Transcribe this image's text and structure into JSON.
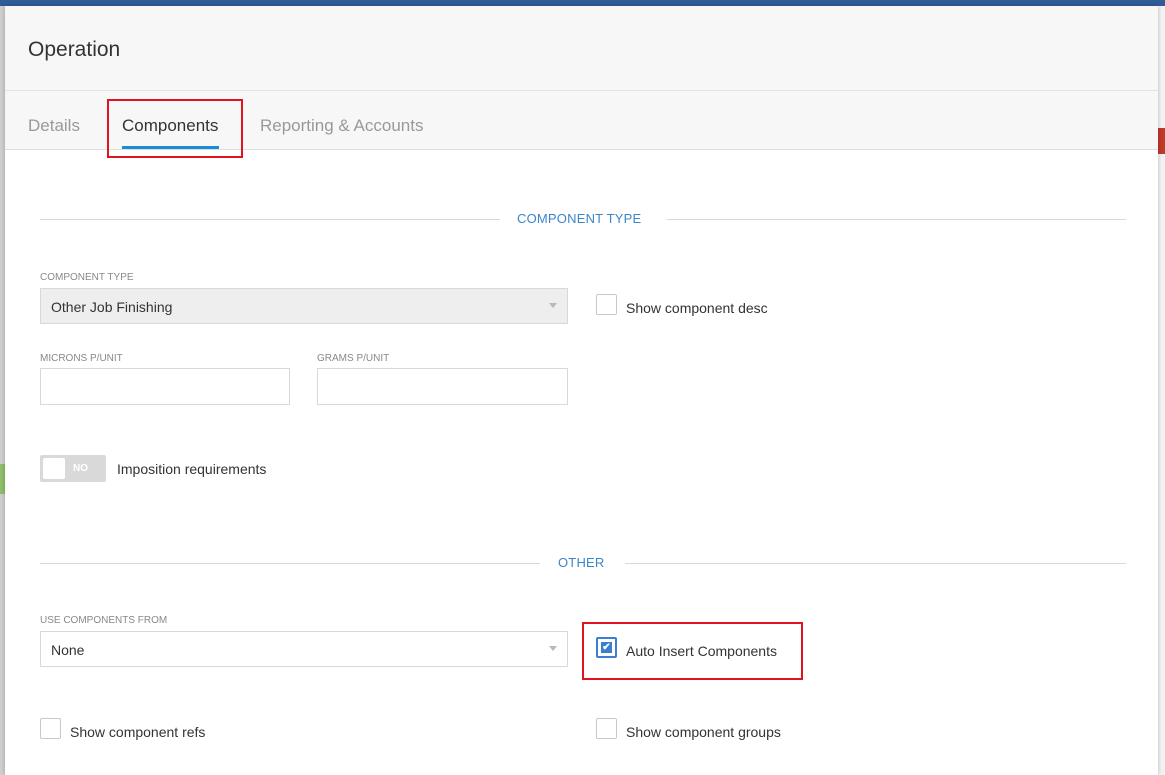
{
  "dialog": {
    "title": "Operation",
    "tabs": [
      {
        "label": "Details"
      },
      {
        "label": "Components"
      },
      {
        "label": "Reporting & Accounts"
      }
    ]
  },
  "component_type_section": {
    "heading": "COMPONENT TYPE",
    "component_type": {
      "label": "COMPONENT TYPE",
      "value": "Other Job Finishing"
    },
    "show_component_desc": {
      "label": "Show component desc",
      "checked": false
    },
    "microns_per_unit": {
      "label": "MICRONS P/UNIT",
      "value": ""
    },
    "grams_per_unit": {
      "label": "GRAMS P/UNIT",
      "value": ""
    },
    "imposition_requirements": {
      "toggle_text": "NO",
      "label": "Imposition requirements"
    }
  },
  "other_section": {
    "heading": "OTHER",
    "use_components_from": {
      "label": "USE COMPONENTS FROM",
      "value": "None"
    },
    "auto_insert_components": {
      "label": "Auto Insert Components",
      "checked": true,
      "check_glyph": "✔"
    },
    "show_component_refs": {
      "label": "Show component refs",
      "checked": false
    },
    "show_component_groups": {
      "label": "Show component groups",
      "checked": false
    }
  },
  "colors": {
    "accent": "#1a8dd6",
    "section": "#3b86c9",
    "highlight": "#e0141e",
    "checkbox_checked": "#3a7fd0"
  }
}
